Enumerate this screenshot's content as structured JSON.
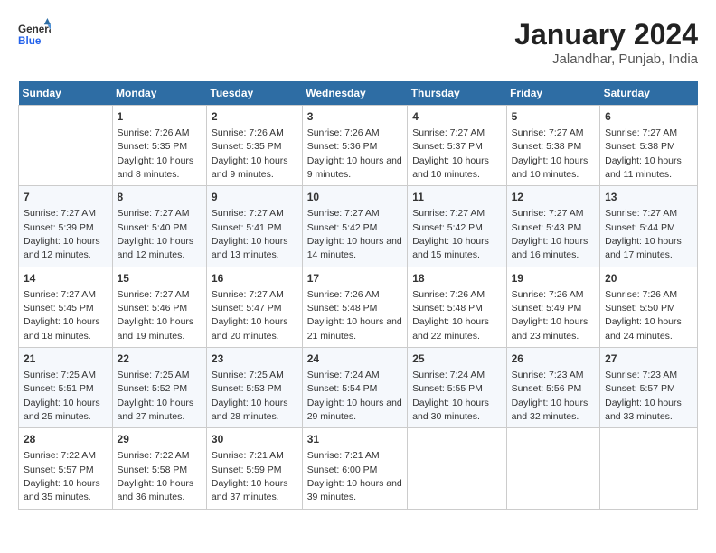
{
  "header": {
    "logo_general": "General",
    "logo_blue": "Blue",
    "month_year": "January 2024",
    "location": "Jalandhar, Punjab, India"
  },
  "days_of_week": [
    "Sunday",
    "Monday",
    "Tuesday",
    "Wednesday",
    "Thursday",
    "Friday",
    "Saturday"
  ],
  "weeks": [
    [
      {
        "day": "",
        "sunrise": "",
        "sunset": "",
        "daylight": ""
      },
      {
        "day": "1",
        "sunrise": "Sunrise: 7:26 AM",
        "sunset": "Sunset: 5:35 PM",
        "daylight": "Daylight: 10 hours and 8 minutes."
      },
      {
        "day": "2",
        "sunrise": "Sunrise: 7:26 AM",
        "sunset": "Sunset: 5:35 PM",
        "daylight": "Daylight: 10 hours and 9 minutes."
      },
      {
        "day": "3",
        "sunrise": "Sunrise: 7:26 AM",
        "sunset": "Sunset: 5:36 PM",
        "daylight": "Daylight: 10 hours and 9 minutes."
      },
      {
        "day": "4",
        "sunrise": "Sunrise: 7:27 AM",
        "sunset": "Sunset: 5:37 PM",
        "daylight": "Daylight: 10 hours and 10 minutes."
      },
      {
        "day": "5",
        "sunrise": "Sunrise: 7:27 AM",
        "sunset": "Sunset: 5:38 PM",
        "daylight": "Daylight: 10 hours and 10 minutes."
      },
      {
        "day": "6",
        "sunrise": "Sunrise: 7:27 AM",
        "sunset": "Sunset: 5:38 PM",
        "daylight": "Daylight: 10 hours and 11 minutes."
      }
    ],
    [
      {
        "day": "7",
        "sunrise": "Sunrise: 7:27 AM",
        "sunset": "Sunset: 5:39 PM",
        "daylight": "Daylight: 10 hours and 12 minutes."
      },
      {
        "day": "8",
        "sunrise": "Sunrise: 7:27 AM",
        "sunset": "Sunset: 5:40 PM",
        "daylight": "Daylight: 10 hours and 12 minutes."
      },
      {
        "day": "9",
        "sunrise": "Sunrise: 7:27 AM",
        "sunset": "Sunset: 5:41 PM",
        "daylight": "Daylight: 10 hours and 13 minutes."
      },
      {
        "day": "10",
        "sunrise": "Sunrise: 7:27 AM",
        "sunset": "Sunset: 5:42 PM",
        "daylight": "Daylight: 10 hours and 14 minutes."
      },
      {
        "day": "11",
        "sunrise": "Sunrise: 7:27 AM",
        "sunset": "Sunset: 5:42 PM",
        "daylight": "Daylight: 10 hours and 15 minutes."
      },
      {
        "day": "12",
        "sunrise": "Sunrise: 7:27 AM",
        "sunset": "Sunset: 5:43 PM",
        "daylight": "Daylight: 10 hours and 16 minutes."
      },
      {
        "day": "13",
        "sunrise": "Sunrise: 7:27 AM",
        "sunset": "Sunset: 5:44 PM",
        "daylight": "Daylight: 10 hours and 17 minutes."
      }
    ],
    [
      {
        "day": "14",
        "sunrise": "Sunrise: 7:27 AM",
        "sunset": "Sunset: 5:45 PM",
        "daylight": "Daylight: 10 hours and 18 minutes."
      },
      {
        "day": "15",
        "sunrise": "Sunrise: 7:27 AM",
        "sunset": "Sunset: 5:46 PM",
        "daylight": "Daylight: 10 hours and 19 minutes."
      },
      {
        "day": "16",
        "sunrise": "Sunrise: 7:27 AM",
        "sunset": "Sunset: 5:47 PM",
        "daylight": "Daylight: 10 hours and 20 minutes."
      },
      {
        "day": "17",
        "sunrise": "Sunrise: 7:26 AM",
        "sunset": "Sunset: 5:48 PM",
        "daylight": "Daylight: 10 hours and 21 minutes."
      },
      {
        "day": "18",
        "sunrise": "Sunrise: 7:26 AM",
        "sunset": "Sunset: 5:48 PM",
        "daylight": "Daylight: 10 hours and 22 minutes."
      },
      {
        "day": "19",
        "sunrise": "Sunrise: 7:26 AM",
        "sunset": "Sunset: 5:49 PM",
        "daylight": "Daylight: 10 hours and 23 minutes."
      },
      {
        "day": "20",
        "sunrise": "Sunrise: 7:26 AM",
        "sunset": "Sunset: 5:50 PM",
        "daylight": "Daylight: 10 hours and 24 minutes."
      }
    ],
    [
      {
        "day": "21",
        "sunrise": "Sunrise: 7:25 AM",
        "sunset": "Sunset: 5:51 PM",
        "daylight": "Daylight: 10 hours and 25 minutes."
      },
      {
        "day": "22",
        "sunrise": "Sunrise: 7:25 AM",
        "sunset": "Sunset: 5:52 PM",
        "daylight": "Daylight: 10 hours and 27 minutes."
      },
      {
        "day": "23",
        "sunrise": "Sunrise: 7:25 AM",
        "sunset": "Sunset: 5:53 PM",
        "daylight": "Daylight: 10 hours and 28 minutes."
      },
      {
        "day": "24",
        "sunrise": "Sunrise: 7:24 AM",
        "sunset": "Sunset: 5:54 PM",
        "daylight": "Daylight: 10 hours and 29 minutes."
      },
      {
        "day": "25",
        "sunrise": "Sunrise: 7:24 AM",
        "sunset": "Sunset: 5:55 PM",
        "daylight": "Daylight: 10 hours and 30 minutes."
      },
      {
        "day": "26",
        "sunrise": "Sunrise: 7:23 AM",
        "sunset": "Sunset: 5:56 PM",
        "daylight": "Daylight: 10 hours and 32 minutes."
      },
      {
        "day": "27",
        "sunrise": "Sunrise: 7:23 AM",
        "sunset": "Sunset: 5:57 PM",
        "daylight": "Daylight: 10 hours and 33 minutes."
      }
    ],
    [
      {
        "day": "28",
        "sunrise": "Sunrise: 7:22 AM",
        "sunset": "Sunset: 5:57 PM",
        "daylight": "Daylight: 10 hours and 35 minutes."
      },
      {
        "day": "29",
        "sunrise": "Sunrise: 7:22 AM",
        "sunset": "Sunset: 5:58 PM",
        "daylight": "Daylight: 10 hours and 36 minutes."
      },
      {
        "day": "30",
        "sunrise": "Sunrise: 7:21 AM",
        "sunset": "Sunset: 5:59 PM",
        "daylight": "Daylight: 10 hours and 37 minutes."
      },
      {
        "day": "31",
        "sunrise": "Sunrise: 7:21 AM",
        "sunset": "Sunset: 6:00 PM",
        "daylight": "Daylight: 10 hours and 39 minutes."
      },
      {
        "day": "",
        "sunrise": "",
        "sunset": "",
        "daylight": ""
      },
      {
        "day": "",
        "sunrise": "",
        "sunset": "",
        "daylight": ""
      },
      {
        "day": "",
        "sunrise": "",
        "sunset": "",
        "daylight": ""
      }
    ]
  ]
}
